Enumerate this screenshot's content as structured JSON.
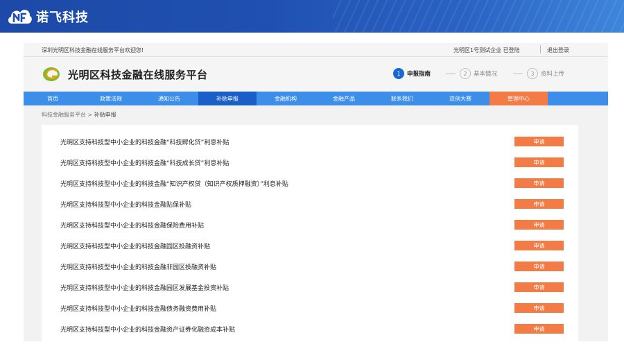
{
  "banner": {
    "company_name": "诺飞科技",
    "logo_icon": "nf-cloud-logo-icon",
    "color": "#1f4fb0"
  },
  "topbar": {
    "welcome": "深圳光明区科技金融在线服务平台欢迎您!",
    "user": "光明区1号测试企业 已登陆",
    "logout": "退出登录"
  },
  "header": {
    "site_title": "光明区科技金融在线服务平台",
    "logo_icon": "g-swirl-logo-icon",
    "steps": [
      {
        "num": "1",
        "label": "申报指南",
        "active": true
      },
      {
        "num": "2",
        "label": "基本情况",
        "active": false
      },
      {
        "num": "3",
        "label": "资料上传",
        "active": false
      }
    ]
  },
  "nav": {
    "items": [
      {
        "label": "首页"
      },
      {
        "label": "政策法规"
      },
      {
        "label": "通知公告"
      },
      {
        "label": "补贴申报",
        "active": true
      },
      {
        "label": "金融机构"
      },
      {
        "label": "金融产品"
      },
      {
        "label": "联系我们"
      },
      {
        "label": "双创大赛"
      },
      {
        "label": "管理中心",
        "highlight": true
      }
    ],
    "colors": {
      "bar": "#3c8ee8",
      "active": "#1a5ec8",
      "highlight": "#f37b46"
    }
  },
  "breadcrumb": {
    "root": "科技金融服务平台",
    "separator": ">",
    "current": "补贴申报"
  },
  "subsidies": {
    "apply_label": "申请",
    "button_color": "#f37b46",
    "items": [
      "光明区支持科技型中小企业的科技金融“科技孵化贷”利息补贴",
      "光明区支持科技型中小企业的科技金融“科技成长贷”利息补贴",
      "光明区支持科技型中小企业的科技金融“知识产权贷（知识产权质押融资）”利息补贴",
      "光明区支持科技型中小企业的科技金融贴保补贴",
      "光明区支持科技型中小企业的科技金融保险费用补贴",
      "光明区支持科技型中小企业的科技金融园区投融资补贴",
      "光明区支持科技型中小企业的科技金融非园区投融资补贴",
      "光明区支持科技型中小企业的科技金融园区发展基金投资补贴",
      "光明区支持科技型中小企业的科技金融债务融资费用补贴",
      "光明区支持科技型中小企业的科技金融资产证券化融资成本补贴"
    ]
  }
}
